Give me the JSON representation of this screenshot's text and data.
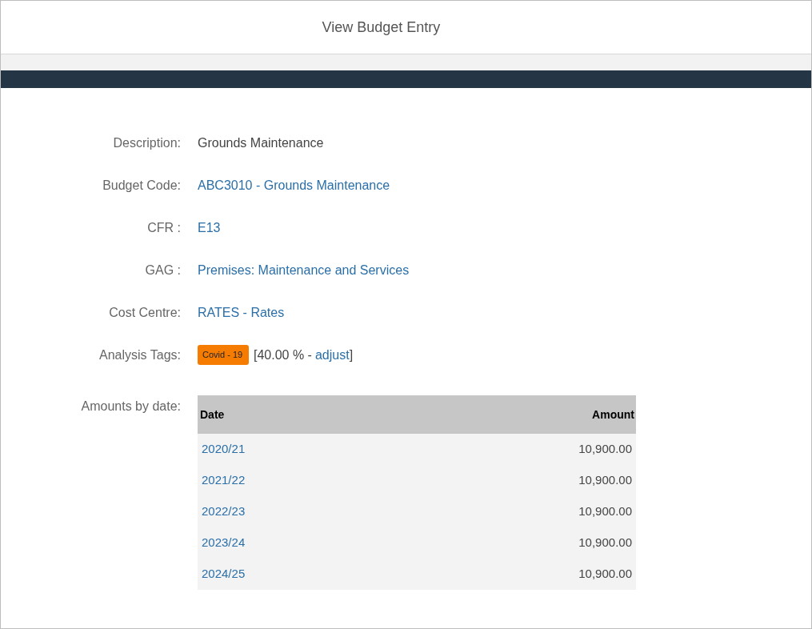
{
  "window": {
    "title": "View Budget Entry"
  },
  "fields": [
    {
      "label": "Description:",
      "kind": "text",
      "value": "Grounds Maintenance"
    },
    {
      "label": "Budget Code:",
      "kind": "link",
      "value": "ABC3010 - Grounds Maintenance"
    },
    {
      "label": "CFR :",
      "kind": "link",
      "value": "E13"
    },
    {
      "label": "GAG :",
      "kind": "link",
      "value": "Premises: Maintenance and Services"
    },
    {
      "label": "Cost Centre:",
      "kind": "link",
      "value": "RATES - Rates"
    }
  ],
  "analysis_tags": {
    "label": "Analysis Tags:",
    "tags": [
      {
        "text": "Covid - 19",
        "color": "#f57c00"
      }
    ],
    "share": "[40.00 % -",
    "link": "adjust",
    "close": "]"
  },
  "amounts": {
    "label": "Amounts by date:",
    "columns": [
      "Date",
      "Amount"
    ],
    "rows": [
      {
        "date": "2020/21",
        "amount": "10,900.00"
      },
      {
        "date": "2021/22",
        "amount": "10,900.00"
      },
      {
        "date": "2022/23",
        "amount": "10,900.00"
      },
      {
        "date": "2023/24",
        "amount": "10,900.00"
      },
      {
        "date": "2024/25",
        "amount": "10,900.00"
      }
    ]
  }
}
